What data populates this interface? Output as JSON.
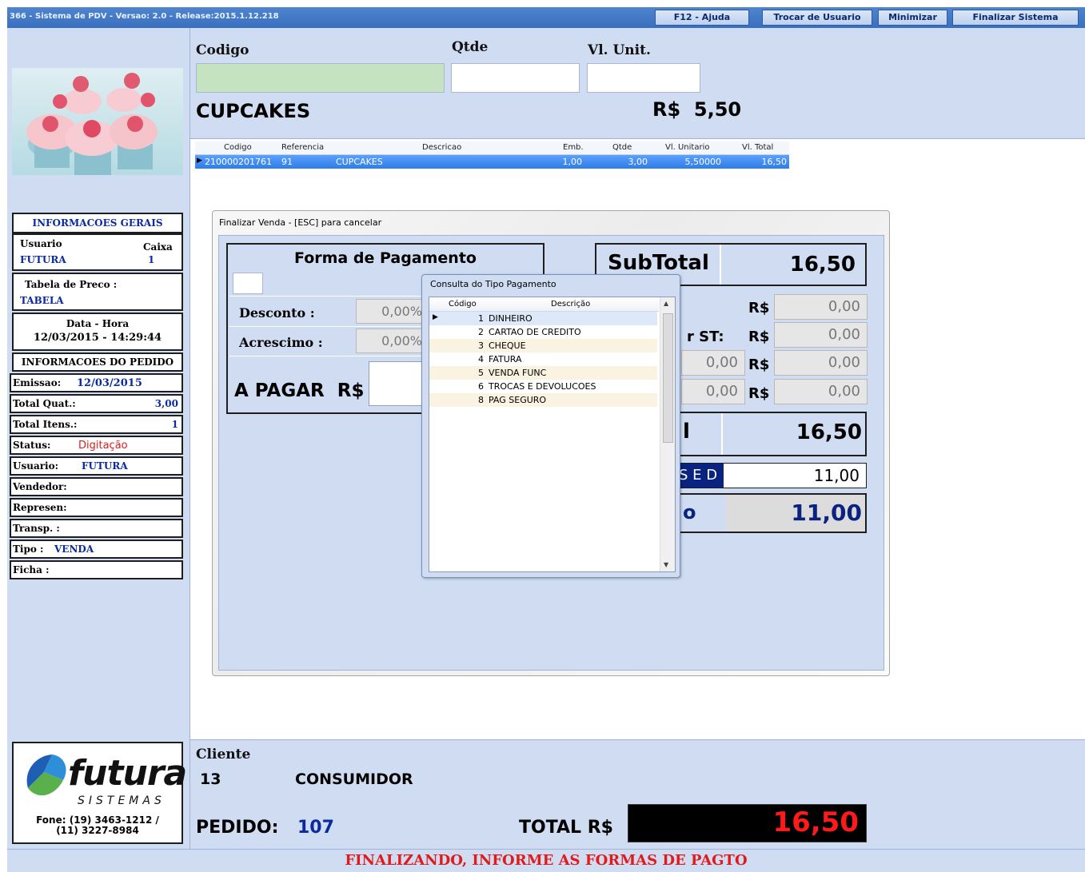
{
  "window": {
    "title": "366 - Sistema de PDV - Versao: 2.0 - Release:2015.1.12.218",
    "buttons": {
      "help": "F12 - Ajuda",
      "switch_user": "Trocar de Usuario",
      "minimize": "Minimizar",
      "exit": "Finalizar Sistema"
    }
  },
  "entry": {
    "codigo_label": "Codigo",
    "qtde_label": "Qtde",
    "vlunit_label": "Vl. Unit.",
    "codigo_value": "",
    "qtde_value": "",
    "vlunit_value": "",
    "product_name": "CUPCAKES",
    "product_price": "R$  5,50"
  },
  "grid": {
    "columns": [
      "Codigo",
      "Referencia",
      "Descricao",
      "Emb.",
      "Qtde",
      "Vl. Unitario",
      "Vl. Total"
    ],
    "rows": [
      {
        "codigo": "210000201761",
        "referencia": "91",
        "descricao": "CUPCAKES",
        "emb": "1,00",
        "qtde": "3,00",
        "vl_unitario": "5,50000",
        "vl_total": "16,50"
      }
    ]
  },
  "sidebar": {
    "info_geral": "INFORMACOES GERAIS",
    "usuario_label": "Usuario",
    "usuario_value": "FUTURA",
    "caixa_label": "Caixa",
    "caixa_value": "1",
    "tabela_label": "Tabela de Preco :",
    "tabela_value": "TABELA",
    "datahora_label": "Data - Hora",
    "datahora_value": "12/03/2015 - 14:29:44",
    "info_pedido": "INFORMACOES DO PEDIDO",
    "emissao_label": "Emissao:",
    "emissao_value": "12/03/2015",
    "totalquat_label": "Total Quat.:",
    "totalquat_value": "3,00",
    "totalitens_label": "Total Itens.:",
    "totalitens_value": "1",
    "status_label": "Status:",
    "status_value": "Digitação",
    "usuario2_label": "Usuario:",
    "usuario2_value": "FUTURA",
    "vendedor_label": "Vendedor:",
    "represen_label": "Represen:",
    "transp_label": "Transp. :",
    "tipo_label": "Tipo :",
    "tipo_value": "VENDA",
    "ficha_label": "Ficha :",
    "logo_text": "futura",
    "logo_sub": "SISTEMAS",
    "phone_line1": "Fone: (19) 3463-1212 /",
    "phone_line2": "(11) 3227-8984"
  },
  "dialog": {
    "caption": "Finalizar Venda - [ESC] para cancelar",
    "forma_title": "Forma de Pagamento",
    "desconto_label": "Desconto :",
    "desconto_value": "0,00%",
    "acrescimo_label": "Acrescimo :",
    "acrescimo_value": "0,00%",
    "apagar_label": "A PAGAR  R$",
    "subtotal_label": "SubTotal",
    "subtotal_value": "16,50",
    "rs": "R$",
    "st_label": "r ST:",
    "line1_value": "0,00",
    "line2_value": "0,00",
    "line3_left": "0,00",
    "line3_value": "0,00",
    "line4_left": "0,00",
    "line4_value": "0,00",
    "total_fragment": "l",
    "total_value": "16,50",
    "sed_label": "S E D",
    "sed_value": "11,00",
    "troco_fragment": "o",
    "troco_value": "11,00"
  },
  "popup": {
    "caption": "Consulta do Tipo Pagamento",
    "col_codigo": "Código",
    "col_descricao": "Descrição",
    "items": [
      {
        "code": "1",
        "desc": "DINHEIRO"
      },
      {
        "code": "2",
        "desc": "CARTAO DE CREDITO"
      },
      {
        "code": "3",
        "desc": "CHEQUE"
      },
      {
        "code": "4",
        "desc": "FATURA"
      },
      {
        "code": "5",
        "desc": "VENDA FUNC"
      },
      {
        "code": "6",
        "desc": "TROCAS E DEVOLUCOES"
      },
      {
        "code": "8",
        "desc": "PAG SEGURO"
      }
    ]
  },
  "footer": {
    "cliente_label": "Cliente",
    "cliente_code": "13",
    "cliente_name": "CONSUMIDOR",
    "pedido_label": "PEDIDO:",
    "pedido_value": "107",
    "total_label": "TOTAL R$",
    "total_value": "16,50",
    "status_message": "FINALIZANDO, INFORME AS FORMAS DE PAGTO"
  },
  "colors": {
    "panel_bg": "#cfdcf2",
    "accent_blue": "#0a2b9e",
    "alert_red": "#e01b1b",
    "selection_blue": "#2f7de6"
  }
}
